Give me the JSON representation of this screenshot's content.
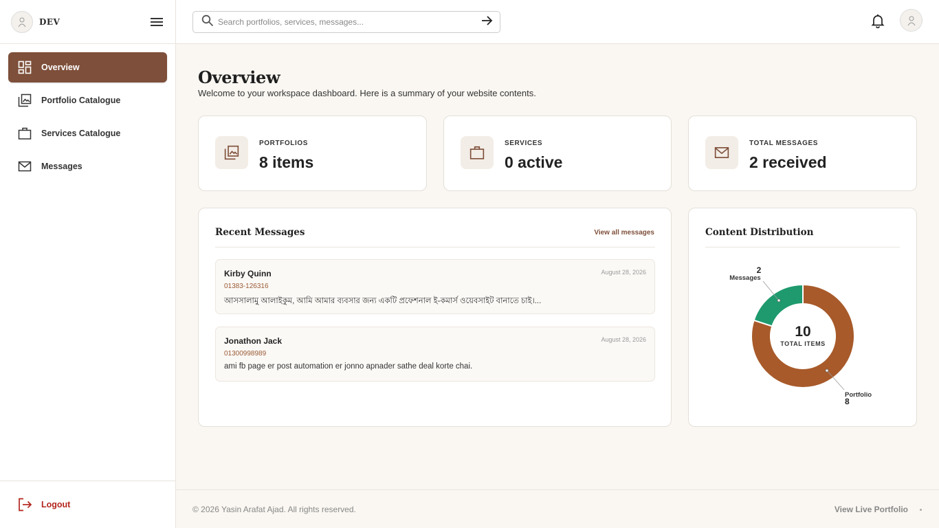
{
  "sidebar": {
    "brand": "DEV",
    "items": [
      {
        "label": "Overview",
        "icon": "dashboard-icon",
        "active": true
      },
      {
        "label": "Portfolio Catalogue",
        "icon": "gallery-icon"
      },
      {
        "label": "Services Catalogue",
        "icon": "briefcase-icon"
      },
      {
        "label": "Messages",
        "icon": "mail-icon"
      }
    ],
    "logout": "Logout"
  },
  "topbar": {
    "search_placeholder": "Search portfolios, services, messages..."
  },
  "page": {
    "title": "Overview",
    "subtitle": "Welcome to your workspace dashboard. Here is a summary of your website contents."
  },
  "stats": [
    {
      "label": "PORTFOLIOS",
      "value": "8 items",
      "icon": "gallery-icon"
    },
    {
      "label": "SERVICES",
      "value": "0 active",
      "icon": "briefcase-icon"
    },
    {
      "label": "TOTAL MESSAGES",
      "value": "2 received",
      "icon": "mail-icon"
    }
  ],
  "recent": {
    "title": "Recent Messages",
    "view_all": "View all messages",
    "messages": [
      {
        "name": "Kirby Quinn",
        "date": "August 28, 2026",
        "phone": "01383-126316",
        "text": "আসসালামু আলাইকুম, আমি আমার ব্যবসার জন্য একটি প্রফেশনাল ই-কমার্স ওয়েবসাইট বানাতে চাই।..."
      },
      {
        "name": "Jonathon Jack",
        "date": "August 28, 2026",
        "phone": "01300998989",
        "text": "ami fb page er post automation er jonno apnader sathe deal korte chai."
      }
    ]
  },
  "distribution": {
    "title": "Content Distribution",
    "total": "10",
    "total_label": "TOTAL ITEMS",
    "labels": {
      "messages_value": "2",
      "messages_name": "Messages",
      "portfolio_name": "Portfolio",
      "portfolio_value": "8"
    }
  },
  "chart_data": {
    "type": "pie",
    "title": "Content Distribution",
    "categories": [
      "Portfolio",
      "Messages"
    ],
    "values": [
      8,
      2
    ],
    "colors": [
      "#a85a2a",
      "#1e9a6e"
    ]
  },
  "footer": {
    "copyright": "© 2026 Yasin Arafat Ajad. All rights reserved.",
    "live_link": "View Live Portfolio"
  },
  "colors": {
    "accent": "#7e4f3a",
    "logout": "#b3261e",
    "portfolio": "#a85a2a",
    "messages": "#1e9a6e"
  }
}
